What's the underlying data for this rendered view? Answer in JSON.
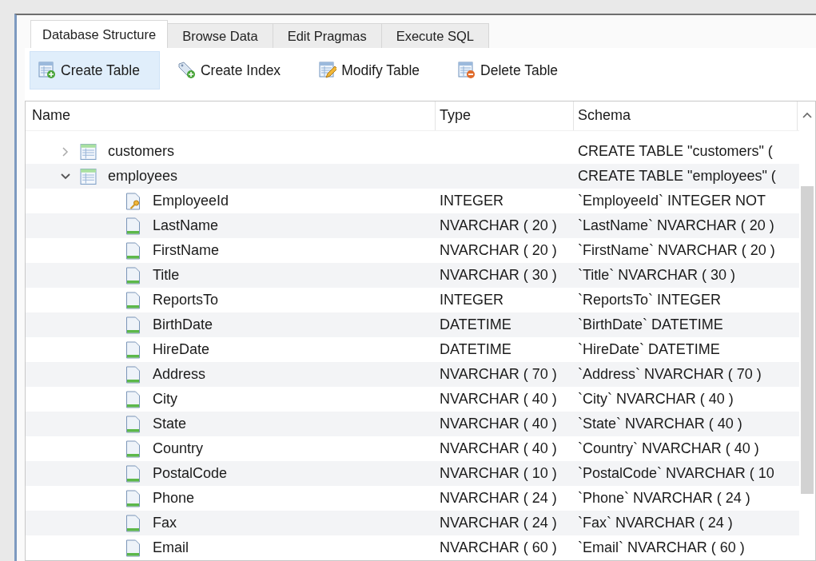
{
  "tabs": [
    {
      "label": "Database Structure",
      "selected": true
    },
    {
      "label": "Browse Data",
      "selected": false
    },
    {
      "label": "Edit Pragmas",
      "selected": false
    },
    {
      "label": "Execute SQL",
      "selected": false
    }
  ],
  "toolbar": [
    {
      "label": "Create Table",
      "kind": "create-table",
      "highlighted": true
    },
    {
      "label": "Create Index",
      "kind": "create-index",
      "highlighted": false
    },
    {
      "label": "Modify Table",
      "kind": "modify-table",
      "highlighted": false
    },
    {
      "label": "Delete Table",
      "kind": "delete-table",
      "highlighted": false
    }
  ],
  "tree": {
    "columns": [
      "Name",
      "Type",
      "Schema"
    ],
    "rows": [
      {
        "name": "customers",
        "kind": "table",
        "expanded": false,
        "schema": "CREATE TABLE \"customers\" ("
      },
      {
        "name": "employees",
        "kind": "table",
        "expanded": true,
        "schema": "CREATE TABLE \"employees\" (",
        "children": [
          {
            "name": "EmployeeId",
            "kind": "key",
            "type": "INTEGER",
            "schema": "`EmployeeId` INTEGER NOT"
          },
          {
            "name": "LastName",
            "kind": "field",
            "type": "NVARCHAR ( 20 )",
            "schema": "`LastName` NVARCHAR ( 20 )"
          },
          {
            "name": "FirstName",
            "kind": "field",
            "type": "NVARCHAR ( 20 )",
            "schema": "`FirstName` NVARCHAR ( 20 )"
          },
          {
            "name": "Title",
            "kind": "field",
            "type": "NVARCHAR ( 30 )",
            "schema": "`Title` NVARCHAR ( 30 )"
          },
          {
            "name": "ReportsTo",
            "kind": "field",
            "type": "INTEGER",
            "schema": "`ReportsTo` INTEGER"
          },
          {
            "name": "BirthDate",
            "kind": "field",
            "type": "DATETIME",
            "schema": "`BirthDate` DATETIME"
          },
          {
            "name": "HireDate",
            "kind": "field",
            "type": "DATETIME",
            "schema": "`HireDate` DATETIME"
          },
          {
            "name": "Address",
            "kind": "field",
            "type": "NVARCHAR ( 70 )",
            "schema": "`Address` NVARCHAR ( 70 )"
          },
          {
            "name": "City",
            "kind": "field",
            "type": "NVARCHAR ( 40 )",
            "schema": "`City` NVARCHAR ( 40 )"
          },
          {
            "name": "State",
            "kind": "field",
            "type": "NVARCHAR ( 40 )",
            "schema": "`State` NVARCHAR ( 40 )"
          },
          {
            "name": "Country",
            "kind": "field",
            "type": "NVARCHAR ( 40 )",
            "schema": "`Country` NVARCHAR ( 40 )"
          },
          {
            "name": "PostalCode",
            "kind": "field",
            "type": "NVARCHAR ( 10 )",
            "schema": "`PostalCode` NVARCHAR ( 10"
          },
          {
            "name": "Phone",
            "kind": "field",
            "type": "NVARCHAR ( 24 )",
            "schema": "`Phone` NVARCHAR ( 24 )"
          },
          {
            "name": "Fax",
            "kind": "field",
            "type": "NVARCHAR ( 24 )",
            "schema": "`Fax` NVARCHAR ( 24 )"
          },
          {
            "name": "Email",
            "kind": "field",
            "type": "NVARCHAR ( 60 )",
            "schema": "`Email` NVARCHAR ( 60 )"
          }
        ]
      }
    ]
  }
}
